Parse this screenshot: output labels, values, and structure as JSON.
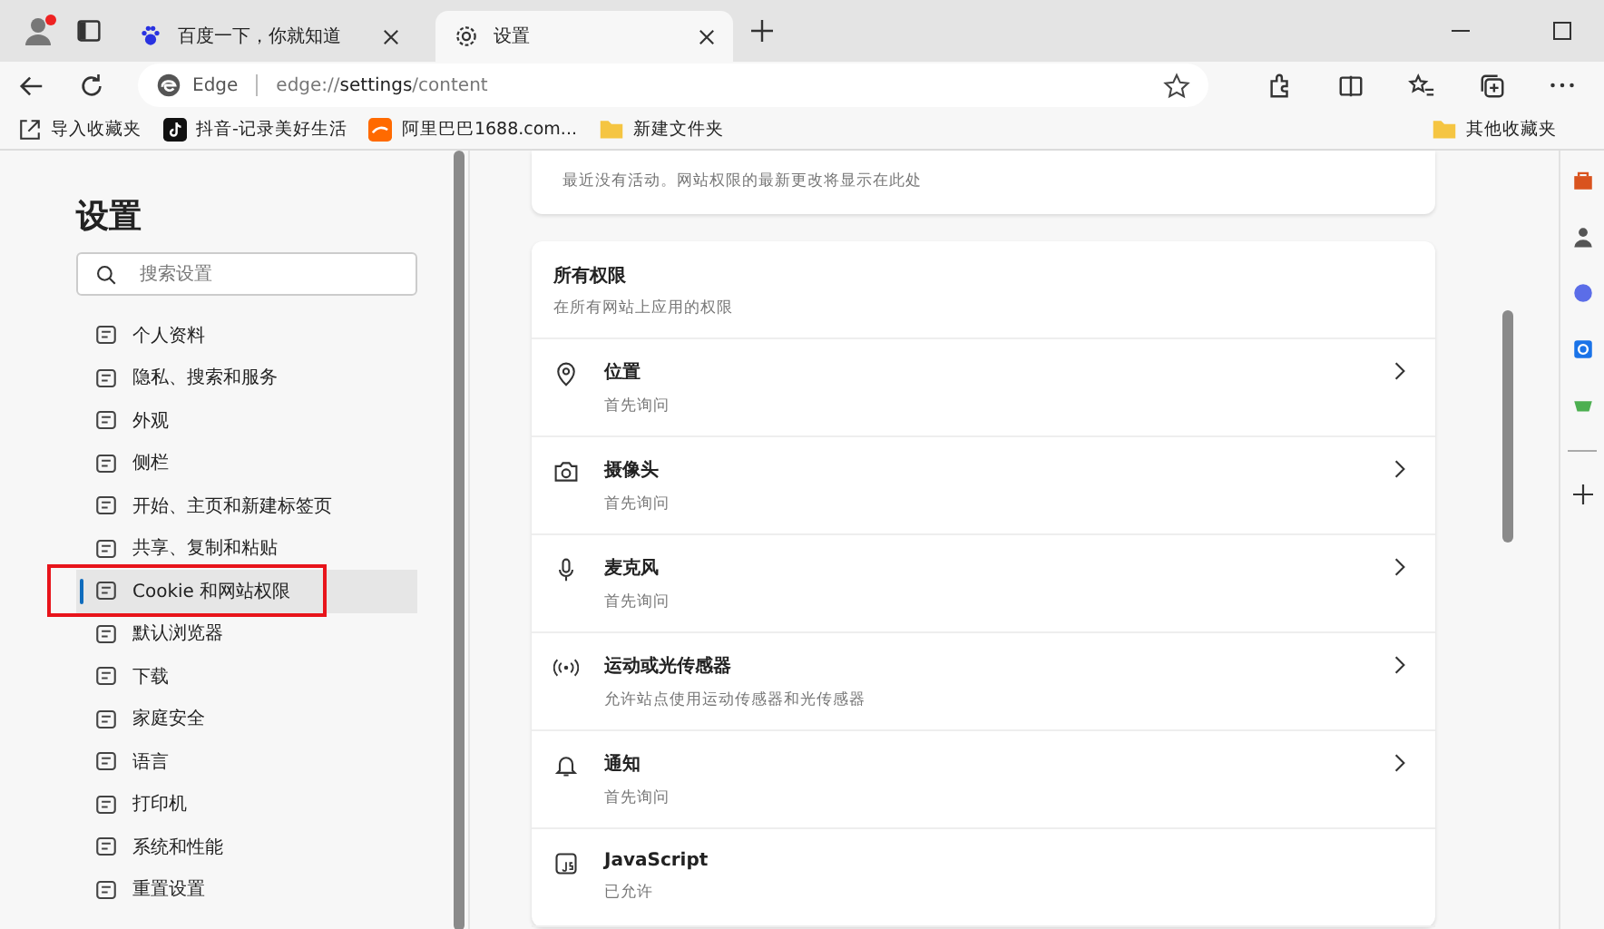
{
  "tabs": [
    {
      "title": "百度一下，你就知道",
      "selected": false
    },
    {
      "title": "设置",
      "selected": true
    }
  ],
  "address_bar": {
    "site_label": "Edge",
    "url": "edge://**settings**/content"
  },
  "bookmarks": [
    {
      "label": "导入收藏夹",
      "kind": "import"
    },
    {
      "label": "抖音-记录美好生活",
      "kind": "site"
    },
    {
      "label": "阿里巴巴1688.com...",
      "kind": "site"
    },
    {
      "label": "新建文件夹",
      "kind": "folder"
    }
  ],
  "other_bookmarks": "其他收藏夹",
  "sidebar": {
    "title": "设置",
    "search": {
      "placeholder": "搜索设置"
    },
    "items": [
      {
        "label": "个人资料",
        "selected": false
      },
      {
        "label": "隐私、搜索和服务",
        "selected": false
      },
      {
        "label": "外观",
        "selected": false
      },
      {
        "label": "侧栏",
        "selected": false
      },
      {
        "label": "开始、主页和新建标签页",
        "selected": false
      },
      {
        "label": "共享、复制和粘贴",
        "selected": false
      },
      {
        "label": "Cookie 和网站权限",
        "selected": true
      },
      {
        "label": "默认浏览器",
        "selected": false
      },
      {
        "label": "下载",
        "selected": false
      },
      {
        "label": "家庭安全",
        "selected": false
      },
      {
        "label": "语言",
        "selected": false
      },
      {
        "label": "打印机",
        "selected": false
      },
      {
        "label": "系统和性能",
        "selected": false
      },
      {
        "label": "重置设置",
        "selected": false
      }
    ]
  },
  "recent_activity": "最近没有活动。网站权限的最新更改将显示在此处",
  "permissions": {
    "title": "所有权限",
    "subtitle": "在所有网站上应用的权限",
    "items": [
      {
        "name": "位置",
        "status": "首先询问",
        "kind": "location"
      },
      {
        "name": "摄像头",
        "status": "首先询问",
        "kind": "camera"
      },
      {
        "name": "麦克风",
        "status": "首先询问",
        "kind": "microphone"
      },
      {
        "name": "运动或光传感器",
        "status": "允许站点使用运动传感器和光传感器",
        "kind": "sensor"
      },
      {
        "name": "通知",
        "status": "首先询问",
        "kind": "notification"
      },
      {
        "name": "JavaScript",
        "status": "已允许",
        "kind": "javascript"
      }
    ]
  }
}
